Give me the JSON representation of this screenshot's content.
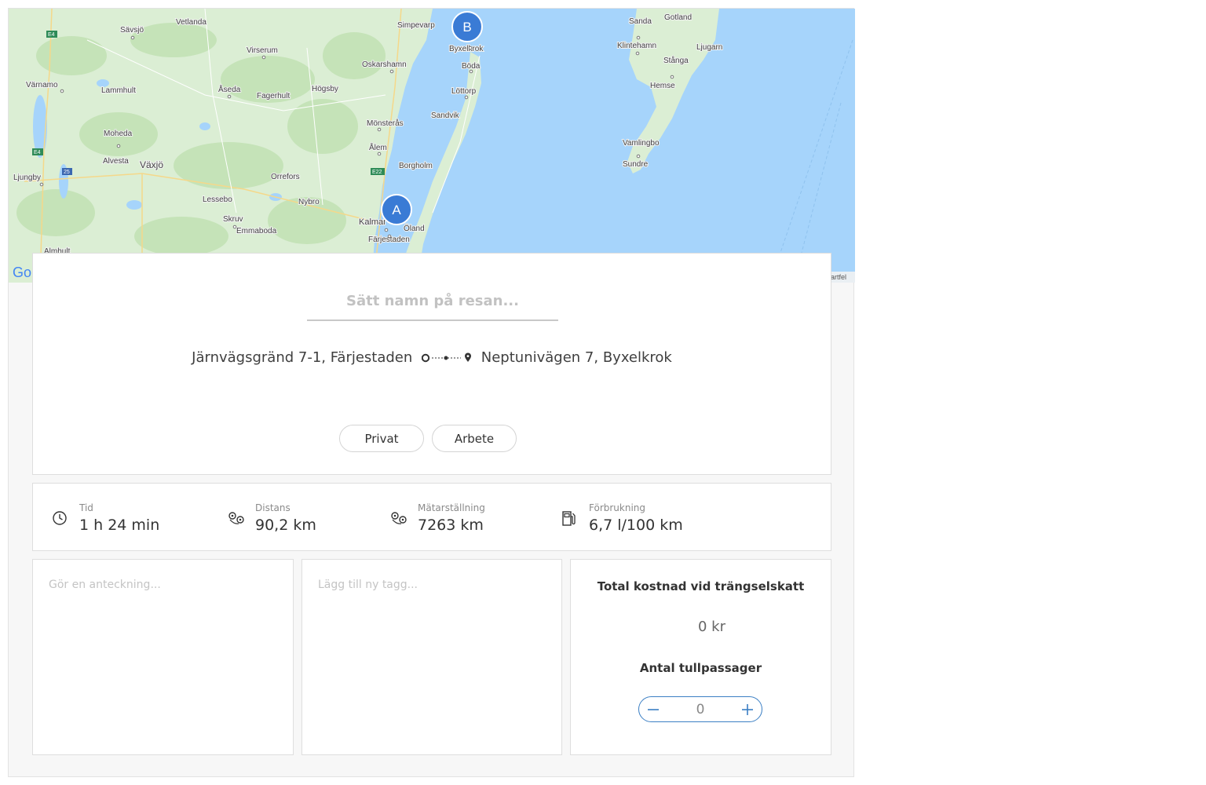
{
  "map": {
    "pins": [
      {
        "label": "A",
        "place": "Kalmar"
      },
      {
        "label": "B",
        "place": "Byxelkrok"
      }
    ],
    "places": [
      "Vetlanda",
      "Sävsjö",
      "Värnamo",
      "Lammhult",
      "Virserum",
      "Åseda",
      "Fagerhult",
      "Högsby",
      "Oskarshamn",
      "Simpevarp",
      "Byxelkrok",
      "Böda",
      "Löttorp",
      "Sandvik",
      "Mönsterås",
      "Ålem",
      "Borgholm",
      "Moheda",
      "Alvesta",
      "Växjö",
      "Ljungby",
      "Orrefors",
      "Lessebo",
      "Nybro",
      "Skruv",
      "Emmaboda",
      "Kalmar",
      "Öland",
      "Färjestaden",
      "Almhult",
      "Sanda",
      "Gotland",
      "Klintehamn",
      "Ljugarn",
      "Stånga",
      "Hemse",
      "Vamlingbo",
      "Sundre"
    ],
    "road_shields": [
      "E4",
      "E4",
      "25",
      "E22"
    ],
    "google_logo": "Go",
    "attribution": "artfel"
  },
  "trip": {
    "name_placeholder": "Sätt namn på resan...",
    "name_value": "",
    "from": "Järnvägsgränd 7-1, Färjestaden",
    "to": "Neptunivägen 7, Byxelkrok",
    "categories": {
      "private": "Privat",
      "work": "Arbete"
    }
  },
  "stats": {
    "time": {
      "label": "Tid",
      "value": "1 h 24 min",
      "icon": "clock-icon"
    },
    "distance": {
      "label": "Distans",
      "value": "90,2 km",
      "icon": "route-icon"
    },
    "odometer": {
      "label": "Mätarställning",
      "value": "7263 km",
      "icon": "route-icon"
    },
    "consumption": {
      "label": "Förbrukning",
      "value": "6,7 l/100 km",
      "icon": "fuel-icon"
    }
  },
  "notes": {
    "placeholder": "Gör en anteckning...",
    "value": ""
  },
  "tags": {
    "placeholder": "Lägg till ny tagg...",
    "value": ""
  },
  "congestion": {
    "title": "Total kostnad vid trängselskatt",
    "cost": "0 kr",
    "passages_title": "Antal tullpassager",
    "passages": "0"
  },
  "colors": {
    "accent": "#3b7fc4",
    "pin": "#3a7bd5",
    "water": "#a6d4fb",
    "land": "#dbeed4"
  }
}
